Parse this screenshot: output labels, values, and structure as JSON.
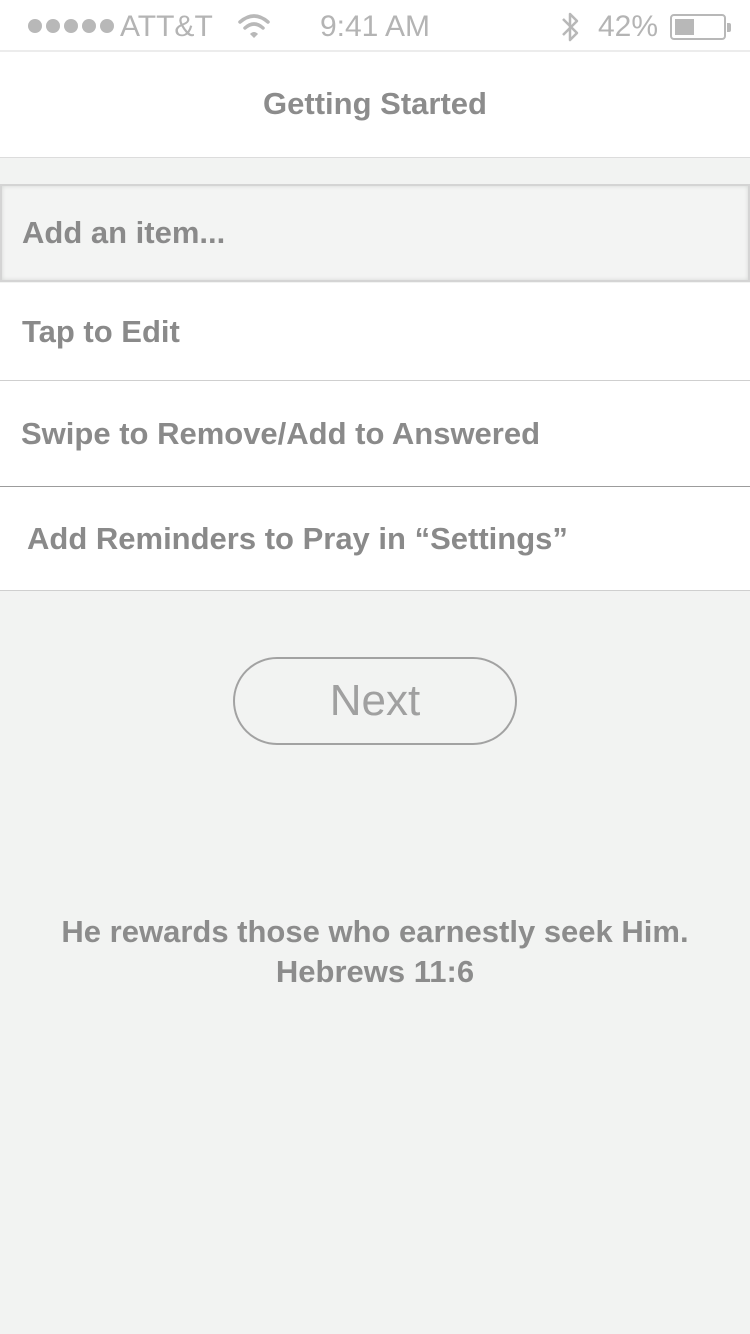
{
  "status_bar": {
    "carrier": "ATT&T",
    "time": "9:41 AM",
    "battery_percent": "42%",
    "battery_level": 0.42,
    "signal_bars": 5,
    "icons": [
      "signal-dots",
      "wifi-icon",
      "bluetooth-icon",
      "battery-icon"
    ]
  },
  "nav": {
    "title": "Getting Started"
  },
  "list": {
    "add_placeholder": "Add an item...",
    "items": [
      {
        "label": "Tap to Edit"
      },
      {
        "label": "Swipe to Remove/Add to Answered"
      },
      {
        "label": "Add Reminders to Pray in “Settings”"
      }
    ]
  },
  "next_button": {
    "label": "Next"
  },
  "verse": {
    "text": "He rewards those who earnestly seek Him.",
    "reference": "Hebrews 11:6"
  },
  "colors": {
    "background": "#f2f3f2",
    "text": "#8a8a8a",
    "status_text": "#b4b4b4",
    "separator": "#cfcfcf"
  }
}
